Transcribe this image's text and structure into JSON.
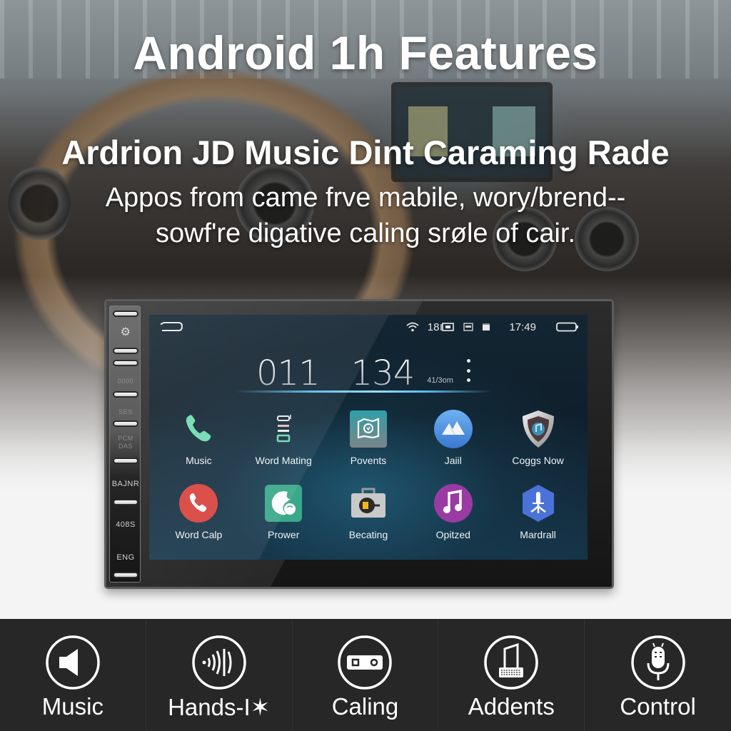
{
  "header": {
    "title": "Android 1h Features",
    "subtitle": "Ardrion JD Music Dint Caraming Rade",
    "description_lines": [
      "Appos from came frve mabile, wory/brend--",
      "sowf're digative caling srøle of cair."
    ]
  },
  "device": {
    "side_panel": {
      "labels": [
        "⚙",
        "0000",
        "SES",
        "PCM\nDAS",
        "BAJNR",
        "408S",
        "ENG"
      ]
    },
    "status_bar": {
      "wifi_icon": "wifi-icon",
      "signal_text": "18",
      "time": "17:49",
      "battery_icon": "battery-icon"
    },
    "clock": {
      "left_digits": "011",
      "right_digits": "134",
      "date_text": "41/3om"
    },
    "apps": [
      {
        "label": "Music",
        "icon": "phone-icon",
        "color": "#6fd9b0"
      },
      {
        "label": "Word Mating",
        "icon": "stack-icon",
        "color": "#6fd9b0"
      },
      {
        "label": "Povents",
        "icon": "frame-icon",
        "color": "#3c8c95"
      },
      {
        "label": "Jaiil",
        "icon": "mountain-icon",
        "color": "#4c8fe0"
      },
      {
        "label": "Coggs Now",
        "icon": "shield-icon",
        "color": "#9a9a9a"
      },
      {
        "label": "Word Calp",
        "icon": "phone-circle-icon",
        "color": "#d8403a"
      },
      {
        "label": "Prower",
        "icon": "pie-icon",
        "color": "#3aa889"
      },
      {
        "label": "Becating",
        "icon": "briefcase-icon",
        "color": "#c8c8c8"
      },
      {
        "label": "Opitzed",
        "icon": "music-note-icon",
        "color": "#9a3aa3"
      },
      {
        "label": "Mardrall",
        "icon": "hex-icon",
        "color": "#4a72d8"
      }
    ]
  },
  "features": [
    {
      "label": "Music",
      "icon": "speaker-icon"
    },
    {
      "label": "Hands-I✶",
      "icon": "sound-waves-icon"
    },
    {
      "label": "Caling",
      "icon": "cassette-icon"
    },
    {
      "label": "Addents",
      "icon": "keyboard-device-icon"
    },
    {
      "label": "Control",
      "icon": "microphone-icon"
    }
  ]
}
